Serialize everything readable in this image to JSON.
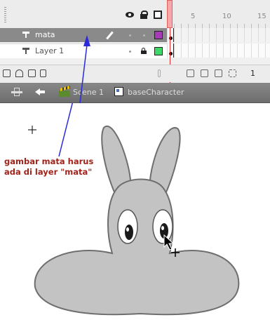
{
  "timeline": {
    "ruler_numbers": [
      "5",
      "10",
      "15"
    ],
    "layers": [
      {
        "name": "mata",
        "selected": true,
        "swatch_color": "#a53bb5"
      },
      {
        "name": "Layer 1",
        "selected": false,
        "swatch_color": "#3fd96a"
      }
    ],
    "frame_number": "1"
  },
  "editbar": {
    "scene_label": "Scene 1",
    "symbol_label": "baseCharacter"
  },
  "annotation": {
    "line1": "gambar mata harus",
    "line2": "ada di layer \"mata\"",
    "color": "#a3231b",
    "arrow_color": "#2a2ad8"
  },
  "character": {
    "fill_color": "#c3c3c3",
    "outline_color": "#6e6e6e"
  }
}
